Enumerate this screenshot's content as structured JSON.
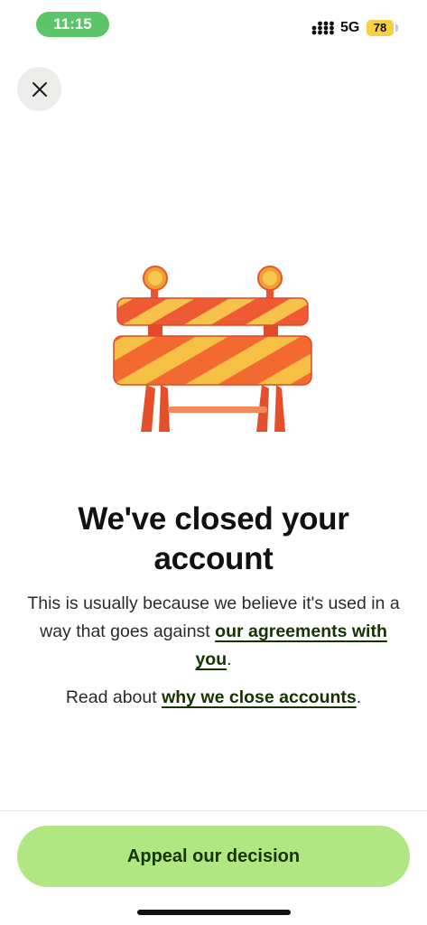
{
  "status_bar": {
    "time": "11:15",
    "network": "5G",
    "battery": "78",
    "icons": [
      "signal-icon",
      "battery-icon"
    ]
  },
  "header": {
    "close_icon": "close-icon"
  },
  "illustration": {
    "icon": "roadblock-barrier-icon"
  },
  "main": {
    "headline_line1": "We've closed your",
    "headline_line2": "account",
    "body_prefix": "This is usually because we believe it's used in a way that goes against ",
    "body_link": "our agreements with you",
    "body_suffix": ".",
    "read_prefix": "Read about ",
    "read_link": "why we close accounts",
    "read_suffix": "."
  },
  "footer": {
    "appeal_label": "Appeal our decision"
  },
  "colors": {
    "accent": "#b1e782",
    "link": "#163300",
    "time_pill": "#5cc56a",
    "battery": "#f5d142"
  }
}
